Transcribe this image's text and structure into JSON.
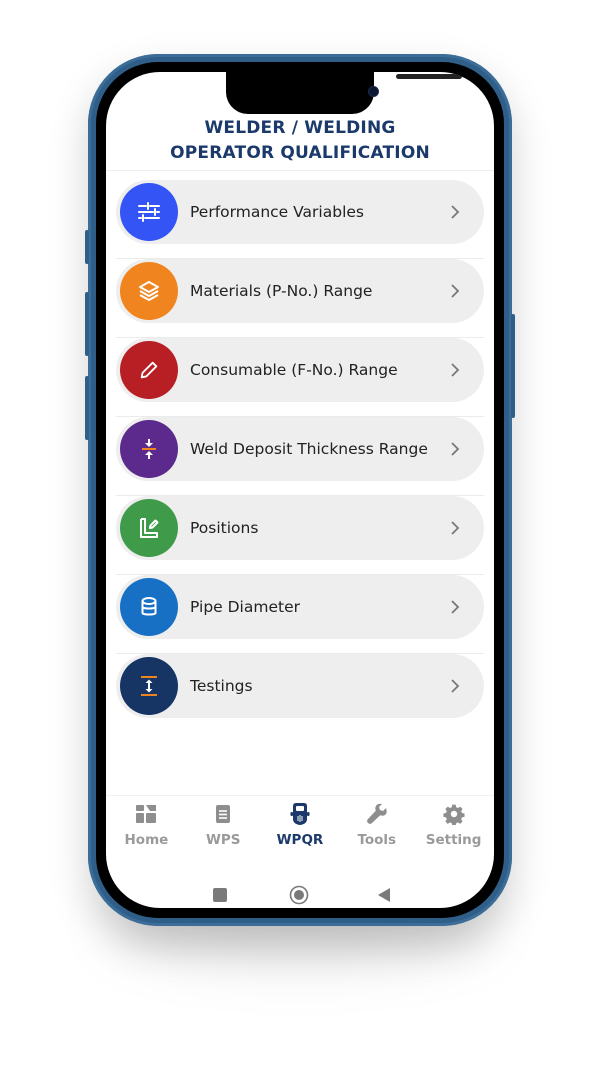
{
  "header": {
    "title_line1": "WELDER / WELDING",
    "title_line2": "OPERATOR QUALIFICATION"
  },
  "menu": {
    "items": [
      {
        "label": "Performance Variables",
        "icon": "sliders-icon",
        "color": "#3454f5"
      },
      {
        "label": "Materials (P-No.) Range",
        "icon": "layers-icon",
        "color": "#f0841e"
      },
      {
        "label": "Consumable (F-No.) Range",
        "icon": "pencil-icon",
        "color": "#b81f24"
      },
      {
        "label": "Weld Deposit Thickness Range",
        "icon": "compress-icon",
        "color": "#5b2a8c"
      },
      {
        "label": "Positions",
        "icon": "square-pen-icon",
        "color": "#3f9b4a"
      },
      {
        "label": "Pipe Diameter",
        "icon": "database-icon",
        "color": "#1870c4"
      },
      {
        "label": "Testings",
        "icon": "height-icon",
        "color": "#163565"
      }
    ]
  },
  "tabbar": {
    "tabs": [
      {
        "label": "Home",
        "icon": "dashboard-icon",
        "active": false
      },
      {
        "label": "WPS",
        "icon": "document-icon",
        "active": false
      },
      {
        "label": "WPQR",
        "icon": "welding-helmet-icon",
        "active": true
      },
      {
        "label": "Tools",
        "icon": "wrench-icon",
        "active": false
      },
      {
        "label": "Setting",
        "icon": "gear-icon",
        "active": false
      }
    ]
  },
  "colors": {
    "accent": "#1b3a6b",
    "frame": "#2f5f88",
    "accent_orange": "#f0841e",
    "inactive": "#9a9a9a"
  }
}
